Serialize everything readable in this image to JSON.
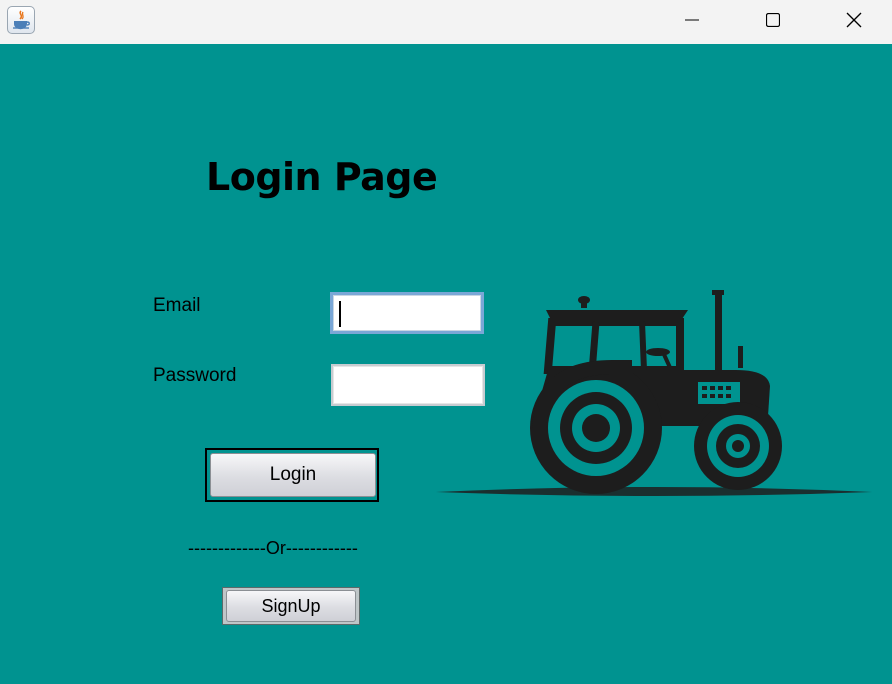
{
  "window": {
    "app_icon": "java-coffee-cup-icon",
    "controls": [
      "minimize-icon",
      "maximize-icon",
      "close-icon"
    ]
  },
  "colors": {
    "background": "#009390",
    "titlebar": "#f3f3f3",
    "text": "#000000"
  },
  "page": {
    "title": "Login Page"
  },
  "form": {
    "email_label": "Email",
    "email_value": "",
    "password_label": "Password",
    "password_value": "",
    "login_label": "Login",
    "separator": "-------------Or------------",
    "signup_label": "SignUp"
  },
  "illustration": {
    "icon": "tractor-icon"
  }
}
